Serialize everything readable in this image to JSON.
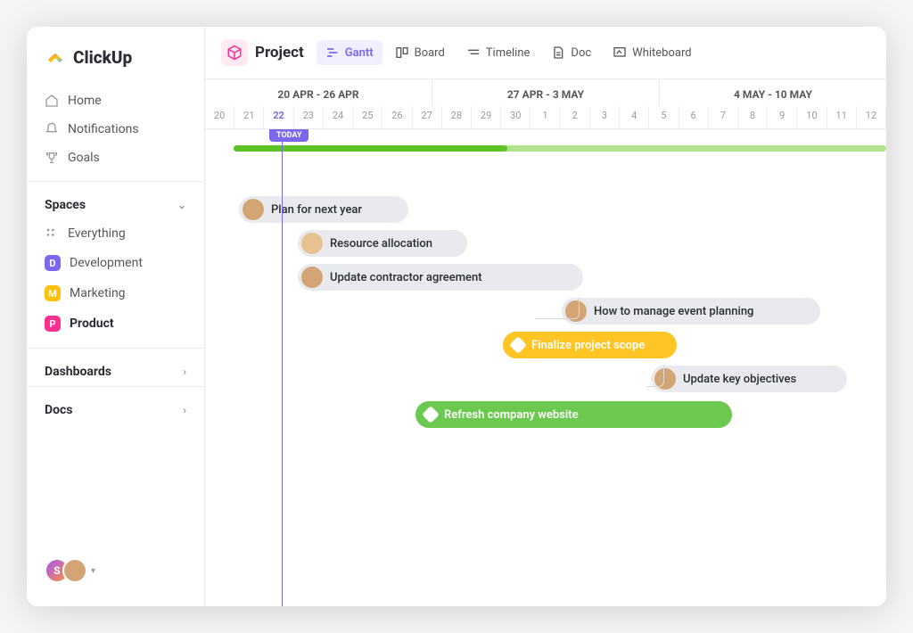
{
  "brand": "ClickUp",
  "nav": {
    "home": "Home",
    "notifications": "Notifications",
    "goals": "Goals"
  },
  "spaces": {
    "header": "Spaces",
    "everything": "Everything",
    "items": [
      {
        "letter": "D",
        "label": "Development"
      },
      {
        "letter": "M",
        "label": "Marketing"
      },
      {
        "letter": "P",
        "label": "Product"
      }
    ]
  },
  "sections": {
    "dashboards": "Dashboards",
    "docs": "Docs"
  },
  "project_title": "Project",
  "tabs": {
    "gantt": "Gantt",
    "board": "Board",
    "timeline": "Timeline",
    "doc": "Doc",
    "whiteboard": "Whiteboard"
  },
  "weeks": [
    "20 APR - 26 APR",
    "27 APR - 3 MAY",
    "4 MAY - 10 MAY"
  ],
  "days": [
    "20",
    "21",
    "22",
    "23",
    "24",
    "25",
    "26",
    "27",
    "28",
    "29",
    "30",
    "1",
    "2",
    "3",
    "4",
    "5",
    "6",
    "7",
    "8",
    "9",
    "10",
    "11",
    "12"
  ],
  "today_label": "TODAY",
  "today_index": 2,
  "avatar_letter": "S",
  "tasks": [
    {
      "label": "Plan for next year"
    },
    {
      "label": "Resource allocation"
    },
    {
      "label": "Update contractor agreement"
    },
    {
      "label": "How to manage event planning"
    },
    {
      "label": "Finalize project scope"
    },
    {
      "label": "Update key objectives"
    },
    {
      "label": "Refresh company website"
    }
  ]
}
